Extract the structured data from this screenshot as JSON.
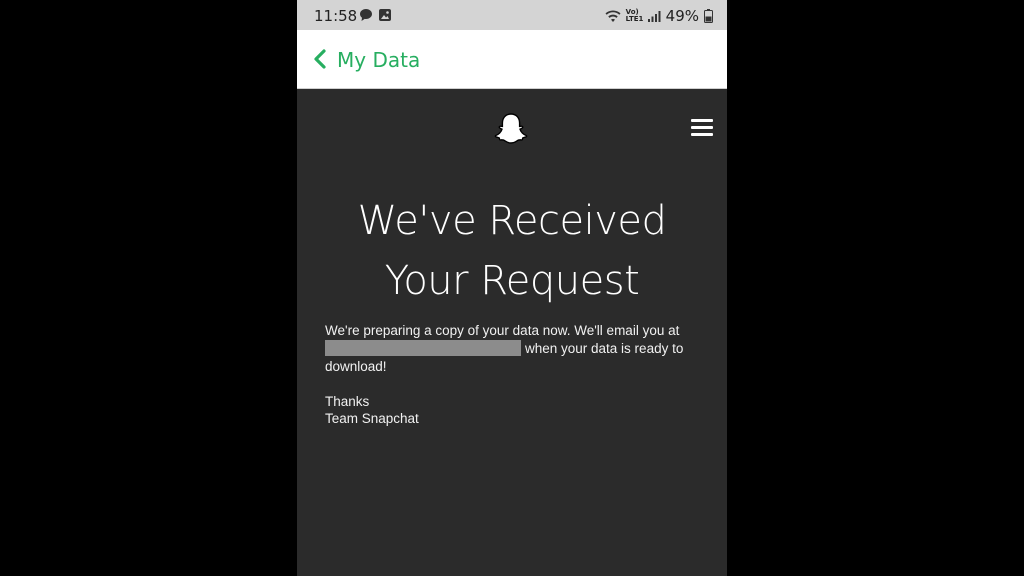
{
  "status_bar": {
    "time": "11:58",
    "network": "Vo) LTE1",
    "battery": "49%"
  },
  "app_bar": {
    "back_icon": "chevron-left-icon",
    "title": "My Data",
    "accent": "#27ae60"
  },
  "page": {
    "logo_icon": "snapchat-ghost-icon",
    "menu_icon": "hamburger-menu-icon",
    "headline_line1": "We've Received",
    "headline_line2": "Your Request",
    "message_part1": "We're preparing a copy of your data now. We'll email you at",
    "message_part2": "when your data is ready to download!",
    "thanks": "Thanks",
    "signature": "Team Snapchat"
  }
}
